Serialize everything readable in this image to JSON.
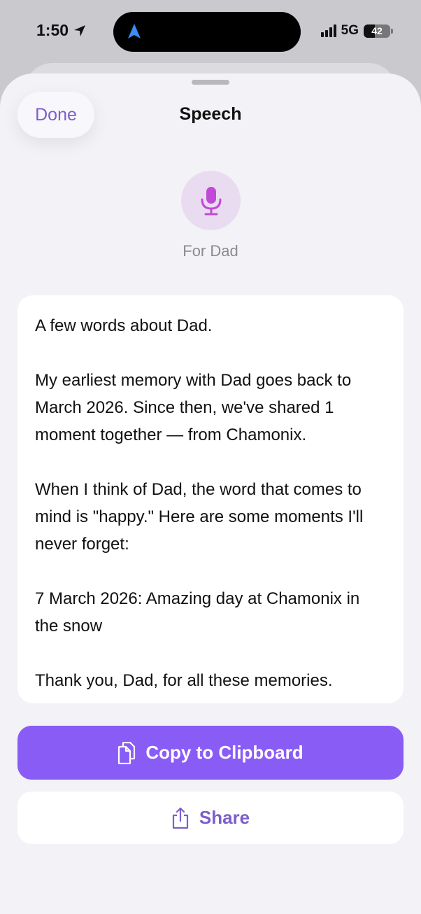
{
  "status_bar": {
    "time": "1:50",
    "network": "5G",
    "battery_level": "42"
  },
  "sheet": {
    "done_label": "Done",
    "title": "Speech",
    "subtitle": "For Dad"
  },
  "speech": {
    "paragraphs": [
      "A few words about Dad.",
      "My earliest memory with Dad goes back to March 2026. Since then, we've shared 1 moment together — from Chamonix.",
      "When I think of Dad, the word that comes to mind is \"happy.\" Here are some moments I'll never forget:",
      "7 March 2026: Amazing day at Chamonix in the snow",
      "Thank you, Dad, for all these memories."
    ]
  },
  "actions": {
    "copy_label": "Copy to Clipboard",
    "share_label": "Share"
  },
  "colors": {
    "accent": "#8a5cf6",
    "accent_text": "#7c5ecb",
    "mic_bg": "#eadcf0",
    "mic_icon": "#c04ad6"
  },
  "icons": {
    "location": "location-arrow-icon",
    "island": "navigation-arrow-icon",
    "mic": "microphone-icon",
    "copy": "documents-icon",
    "share": "share-icon"
  }
}
